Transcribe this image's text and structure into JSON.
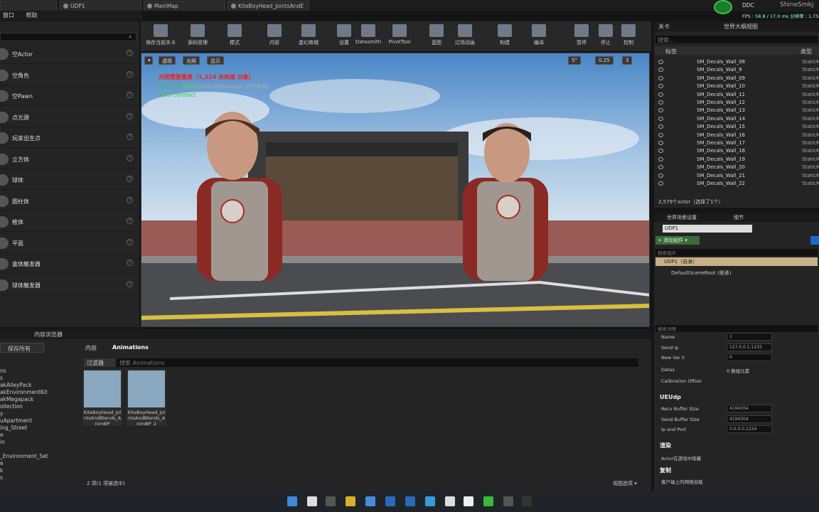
{
  "tabs": [
    "UDP1",
    "MainMap",
    "KiteBoyHead_JointsAndE"
  ],
  "menu": [
    "窗口",
    "帮助"
  ],
  "topright": {
    "ddc": "DDC",
    "user": "ShineSmkj",
    "fps": "FPS : 58.8 / 17.0 ms  分辨率 : 1,757.24"
  },
  "toolbar": [
    "保存当前关卡",
    "源码管理",
    "模式",
    "内容",
    "虚幻商城",
    "设置",
    "Datasmith",
    "PivotTool",
    "蓝图",
    "过场动画",
    "构建",
    "编译",
    "暂停",
    "停止",
    "控制"
  ],
  "actors": [
    "空Actor",
    "空角色",
    "空Pawn",
    "点光源",
    "玩家出生点",
    "立方体",
    "球体",
    "圆柱体",
    "椎体",
    "平面",
    "盒体触发器",
    "球体触发器"
  ],
  "viewport": {
    "perspective": "透视",
    "lit": "光照",
    "show": "显示",
    "msg1": "光照需要重建（1,324 未构建 对象）",
    "msg2": "auto connect",
    "msg2b": "leAllScreenMessages\"进行抑制",
    "msg3": "auto connect",
    "snap_angle": "5°",
    "snap_scale": "0.25",
    "cam_speed": "3"
  },
  "outliner": {
    "tab1": "关卡",
    "tab2": "世界大纲视图",
    "search": "搜索...",
    "col_label": "标签",
    "col_type": "类型",
    "rows": [
      "SM_Decals_Wall_08",
      "SM_Decals_Wall_9",
      "SM_Decals_Wall_09",
      "SM_Decals_Wall_10",
      "SM_Decals_Wall_11",
      "SM_Decals_Wall_12",
      "SM_Decals_Wall_13",
      "SM_Decals_Wall_14",
      "SM_Decals_Wall_15",
      "SM_Decals_Wall_16",
      "SM_Decals_Wall_17",
      "SM_Decals_Wall_18",
      "SM_Decals_Wall_19",
      "SM_Decals_Wall_20",
      "SM_Decals_Wall_21",
      "SM_Decals_Wall_22"
    ],
    "type": "StaticMe",
    "count": "2,579个actor（选择了1个）"
  },
  "details": {
    "tab1": "世界场景设置",
    "tab2": "细节",
    "name": "UDP1",
    "add": "+ 添加组件 ▾",
    "search_comp": "搜索组件",
    "self": "UDP1（自身）",
    "root": "DefaultSceneRoot (继承)",
    "search_detail": "搜索详情",
    "rows": [
      [
        "Name",
        "1"
      ],
      [
        "Send Ip",
        "127.0.0.1:1235"
      ],
      [
        "New Var 0",
        "0"
      ]
    ],
    "datas": "Datas",
    "datas_val": "0 数组元素",
    "calib": "Calibration Offset",
    "sec_ueudp": "UEUdp",
    "udp_rows": [
      [
        "Recv Buffer Size",
        "4194304"
      ],
      [
        "Send Buffer Size",
        "4194304"
      ],
      [
        "Ip and Port",
        "0.0.0.0:1234"
      ]
    ],
    "sec_render": "渲染",
    "render_row": "Actor在游戏中隐藏",
    "sec_copy": "复制",
    "copy_row": "客户端上的网络加载"
  },
  "content": {
    "tab": "内容浏览器",
    "save_all": "保存所有",
    "path1": "内容",
    "path2": "Animations",
    "filter": "过滤器",
    "search": "搜索 Animations",
    "folders": [
      "ns",
      "s",
      "akAlleyPack",
      "akEnvironmentKit",
      "akMegapack",
      "ollection",
      "y",
      "uApartment",
      "ing_Street",
      "e",
      "in",
      "",
      "_Environment_Set",
      "e",
      "k",
      "s"
    ],
    "assets": [
      "KiteBoyHead_JointsAndBlends_AnimBP",
      "KiteBoyHead_JointsAndBlends_AnimBP_2"
    ],
    "status": "2 项(1 项被选中)",
    "view": "视图选项 ▾"
  }
}
